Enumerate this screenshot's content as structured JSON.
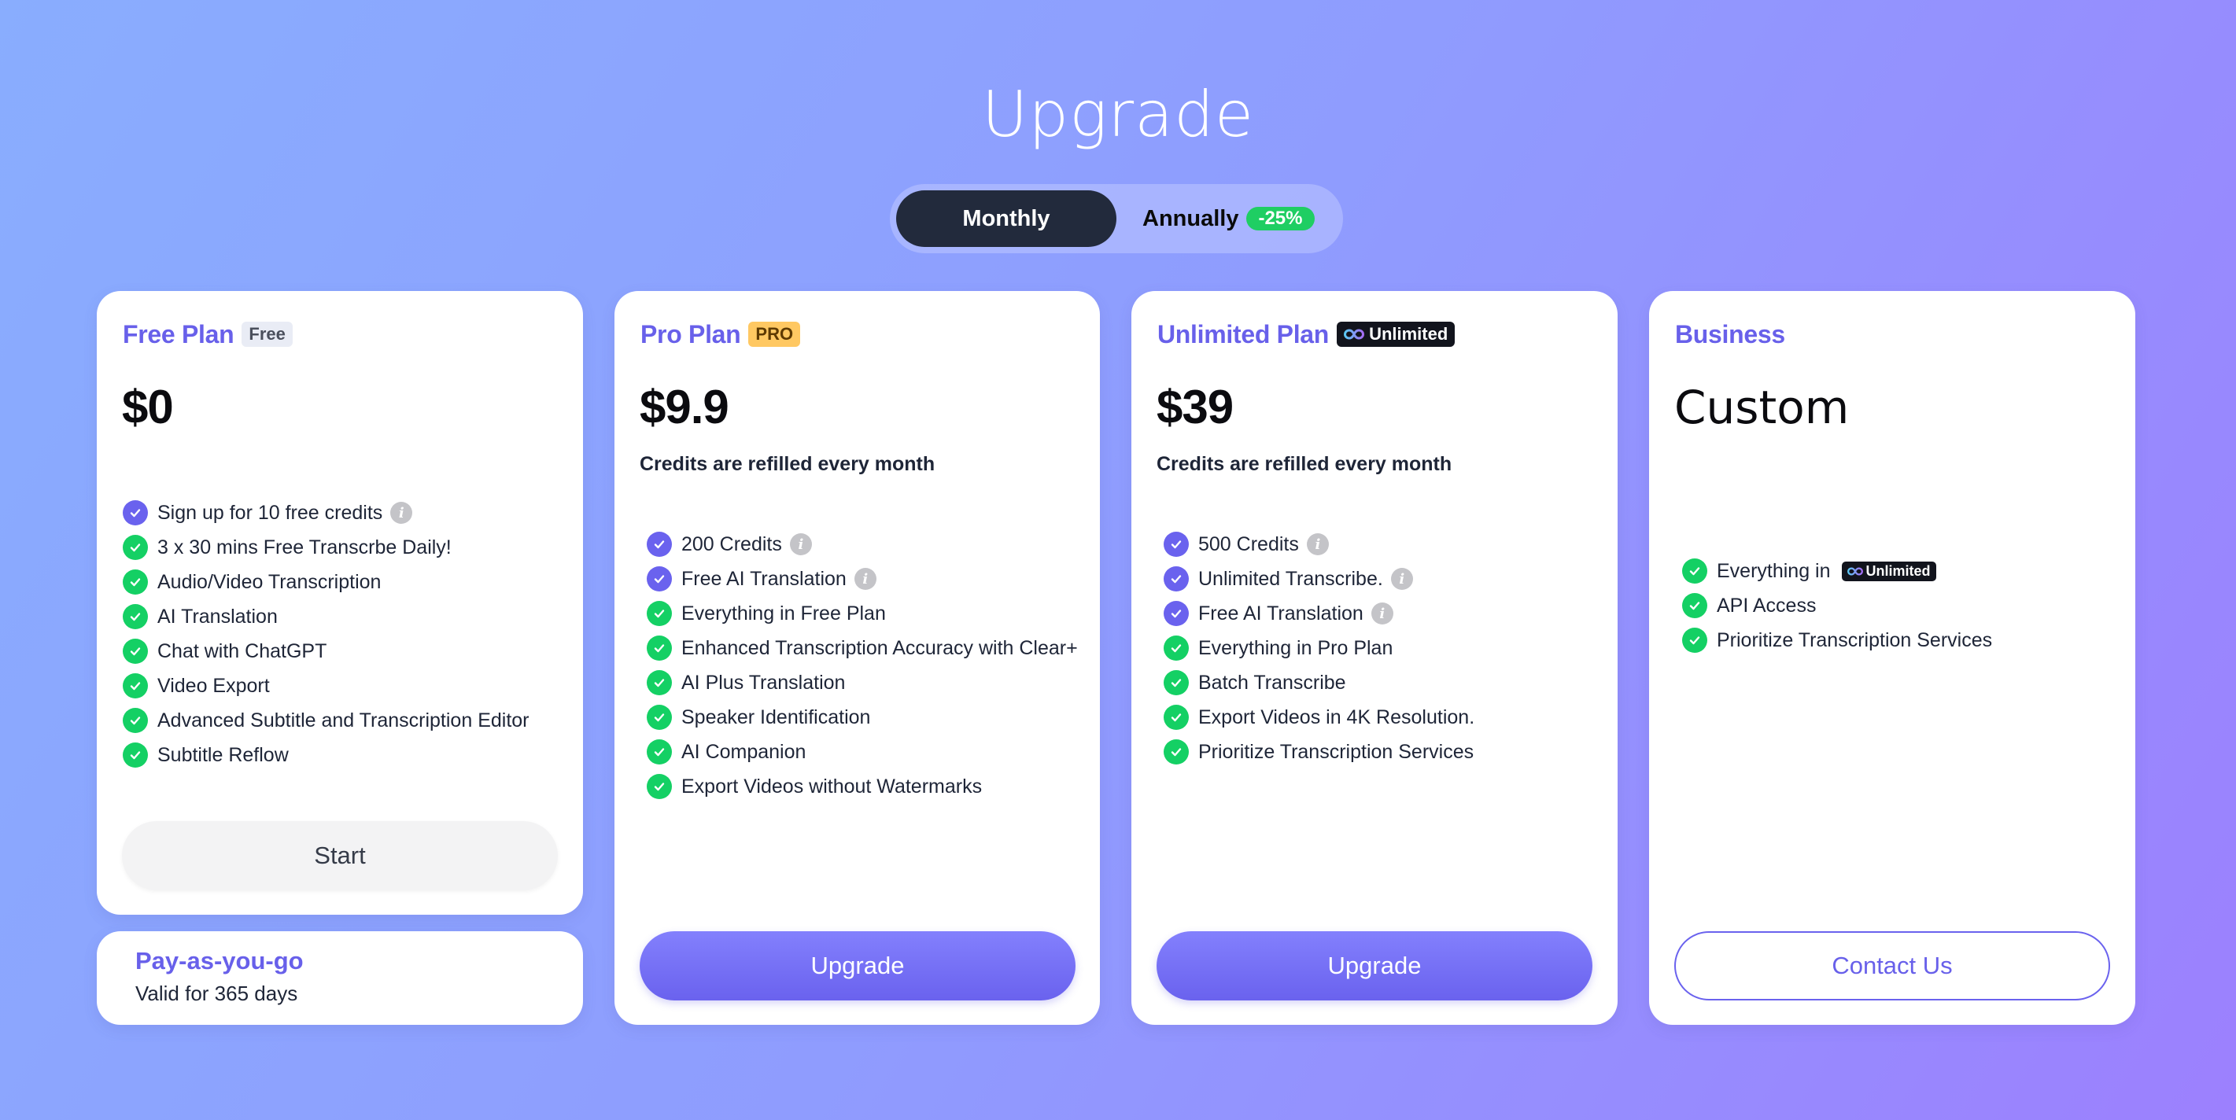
{
  "page": {
    "title": "Upgrade",
    "colors": {
      "accent": "#6860ea",
      "check_purple": "#6a62ee",
      "check_green": "#14d064",
      "discount": "#1fce63",
      "toggle_active": "#222a3c",
      "pro_tag": "#ffc862"
    }
  },
  "billing_toggle": {
    "options": [
      {
        "label": "Monthly",
        "selected": true
      },
      {
        "label": "Annually",
        "selected": false,
        "badge": "-25%"
      }
    ]
  },
  "plans": [
    {
      "name": "Free Plan",
      "tag": "Free",
      "price": "$0",
      "features": [
        {
          "text": "Sign up for 10 free credits",
          "icon": "check-purple",
          "info": true
        },
        {
          "text": "3 x 30 mins Free Transcrbe Daily!",
          "icon": "check-green",
          "info": false
        },
        {
          "text": "Audio/Video Transcription",
          "icon": "check-green",
          "info": false
        },
        {
          "text": "AI Translation",
          "icon": "check-green",
          "info": false
        },
        {
          "text": "Chat with ChatGPT",
          "icon": "check-green",
          "info": false
        },
        {
          "text": "Video Export",
          "icon": "check-green",
          "info": false
        },
        {
          "text": "Advanced Subtitle and Transcription Editor",
          "icon": "check-green",
          "info": false
        },
        {
          "text": "Subtitle Reflow",
          "icon": "check-green",
          "info": false
        }
      ],
      "button": "Start"
    },
    {
      "name": "Pro Plan",
      "tag": "PRO",
      "price": "$9.9",
      "subtitle": "Credits are refilled every month",
      "features": [
        {
          "text": "200 Credits",
          "icon": "check-purple",
          "info": true
        },
        {
          "text": "Free AI Translation",
          "icon": "check-purple",
          "info": true
        },
        {
          "text": "Everything in Free Plan",
          "icon": "check-green",
          "info": false
        },
        {
          "text": "Enhanced Transcription Accuracy with Clear+",
          "icon": "check-green",
          "info": false
        },
        {
          "text": "AI Plus Translation",
          "icon": "check-green",
          "info": false
        },
        {
          "text": "Speaker Identification",
          "icon": "check-green",
          "info": false
        },
        {
          "text": "AI Companion",
          "icon": "check-green",
          "info": false
        },
        {
          "text": "Export Videos without Watermarks",
          "icon": "check-green",
          "info": false
        }
      ],
      "button": "Upgrade"
    },
    {
      "name": "Unlimited Plan",
      "tag": "Unlimited",
      "tag_icon": "infinity-icon",
      "price": "$39",
      "subtitle": "Credits are refilled every month",
      "features": [
        {
          "text": "500 Credits",
          "icon": "check-purple",
          "info": true
        },
        {
          "text": "Unlimited Transcribe.",
          "icon": "check-purple",
          "info": true
        },
        {
          "text": "Free AI Translation",
          "icon": "check-purple",
          "info": true
        },
        {
          "text": "Everything in Pro Plan",
          "icon": "check-green",
          "info": false
        },
        {
          "text": "Batch Transcribe",
          "icon": "check-green",
          "info": false
        },
        {
          "text": "Export Videos in 4K Resolution.",
          "icon": "check-green",
          "info": false
        },
        {
          "text": "Prioritize Transcription Services",
          "icon": "check-green",
          "info": false
        }
      ],
      "button": "Upgrade"
    },
    {
      "name": "Business",
      "price": "Custom",
      "features": [
        {
          "text": "Everything in",
          "icon": "check-green",
          "info": false,
          "inline_tag": "Unlimited"
        },
        {
          "text": "API Access",
          "icon": "check-green",
          "info": false
        },
        {
          "text": "Prioritize Transcription Services",
          "icon": "check-green",
          "info": false
        }
      ],
      "button": "Contact Us"
    }
  ],
  "pay_as_you_go": {
    "title": "Pay-as-you-go",
    "subtitle": "Valid for 365 days"
  },
  "icons": {
    "check": "check-circle-icon",
    "info": "info-icon",
    "info_glyph": "i",
    "infinity": "infinity-icon"
  }
}
